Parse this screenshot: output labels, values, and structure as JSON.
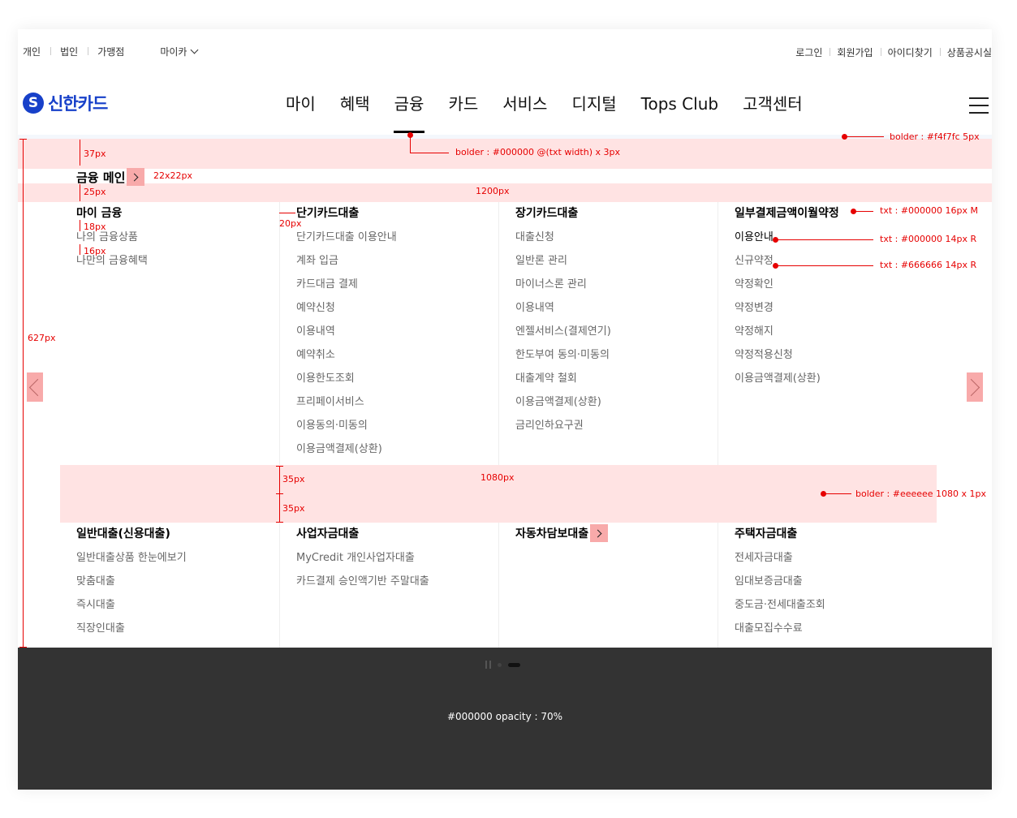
{
  "utility": {
    "left": [
      "개인",
      "법인",
      "가맹점"
    ],
    "mycar": "마이카",
    "right": [
      "로그인",
      "회원가입",
      "아이디찾기",
      "상품공시실"
    ]
  },
  "logo": {
    "mark": "S",
    "text": "신한카드"
  },
  "gnb": [
    "마이",
    "혜택",
    "금융",
    "카드",
    "서비스",
    "디지털",
    "Tops Club",
    "고객센터"
  ],
  "active_gnb": "금융",
  "menu": {
    "title": "금융 메인",
    "row1": [
      {
        "title": "마이 금융",
        "items": [
          "나의 금융상품",
          "나만의 금융혜택"
        ]
      },
      {
        "title": "단기카드대출",
        "items": [
          "단기카드대출 이용안내",
          "계좌 입금",
          "카드대금 결제",
          "예약신청",
          "이용내역",
          "예약취소",
          "이용한도조회",
          "프리페이서비스",
          "이용동의·미동의",
          "이용금액결제(상환)"
        ]
      },
      {
        "title": "장기카드대출",
        "items": [
          "대출신청",
          "일반론 관리",
          "마이너스론 관리",
          "이용내역",
          "엔젤서비스(결제연기)",
          "한도부여 동의·미동의",
          "대출계약 철회",
          "이용금액결제(상환)",
          "금리인하요구권"
        ]
      },
      {
        "title": "일부결제금액이월약정",
        "items": [
          "이용안내",
          "신규약정",
          "약정확인",
          "약정변경",
          "약정해지",
          "약정적용신청",
          "이용금액결제(상환)"
        ]
      }
    ],
    "row2": [
      {
        "title": "일반대출(신용대출)",
        "items": [
          "일반대출상품 한눈에보기",
          "맞춤대출",
          "즉시대출",
          "직장인대출"
        ]
      },
      {
        "title": "사업자금대출",
        "items": [
          "MyCredit 개인사업자대출",
          "카드결제 승인액기반 주말대출"
        ]
      },
      {
        "title": "자동차담보대출",
        "items": []
      },
      {
        "title": "주택자금대출",
        "items": [
          "전세자금대출",
          "임대보증금대출",
          "중도금·전세대출조회",
          "대출모집수수료"
        ]
      }
    ]
  },
  "spec": {
    "gnb_border": "bolder : #000000  @(txt width) x 3px",
    "header_border": "bolder : #f4f7fc  5px",
    "v37": "37px",
    "v25": "25px",
    "arrow_size": "22x22px",
    "width1200": "1200px",
    "v18": "18px",
    "v16": "16px",
    "h20": "20px",
    "txt_title": "txt : #000000  16px  M",
    "txt_item_dark": "txt : #000000  14px  R",
    "txt_item_gray": "txt :  #666666  14px  R",
    "height627": "627px",
    "v35a": "35px",
    "v35b": "35px",
    "width1080": "1080px",
    "divider_border": "bolder : #eeeeee  1080 x 1px",
    "dim": "#000000 opacity : 70%"
  },
  "colors": {
    "brand": "#1740c9",
    "annotation": "#e60000",
    "dim": "#333333"
  }
}
